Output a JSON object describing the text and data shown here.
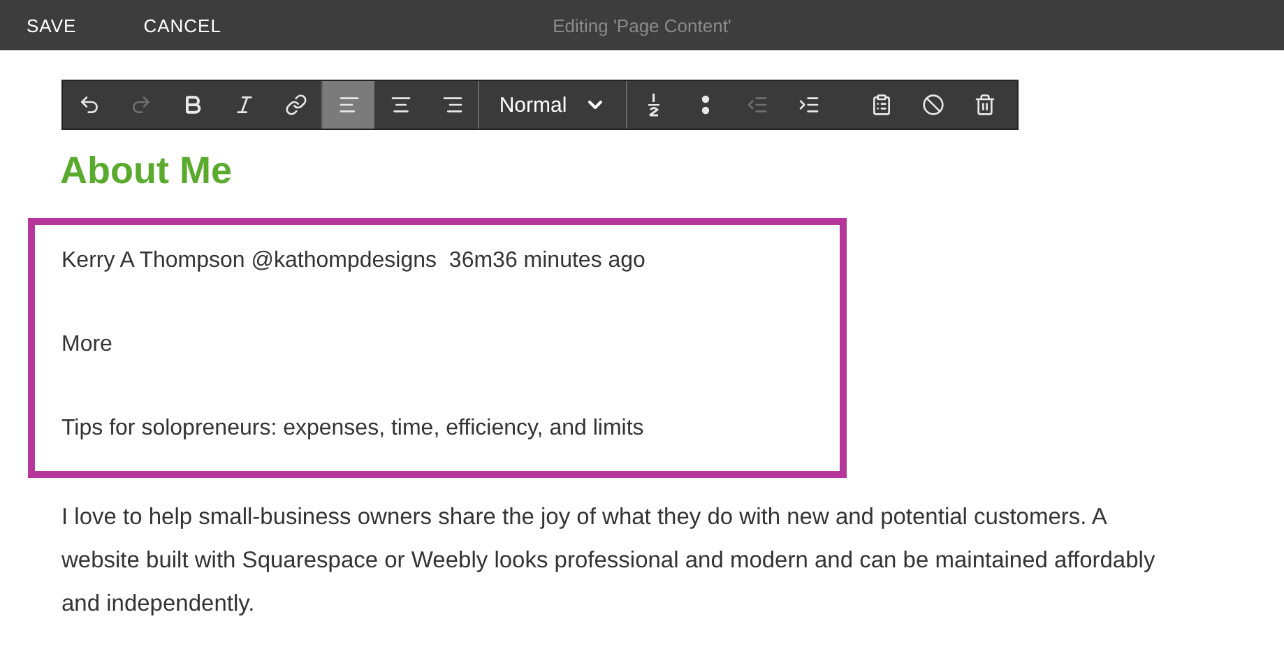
{
  "top_bar": {
    "buttons": [
      "SAVE",
      "CANCEL"
    ],
    "title": "Editing 'Page Content'"
  },
  "toolbar": {
    "groups": [
      {
        "kind": "buttons",
        "items": [
          {
            "kind": "undo",
            "disabled": false,
            "selected": false
          },
          {
            "kind": "redo",
            "disabled": true,
            "selected": false
          },
          {
            "kind": "bold",
            "disabled": false,
            "selected": false
          },
          {
            "kind": "italic",
            "disabled": false,
            "selected": false
          },
          {
            "kind": "link",
            "disabled": false,
            "selected": false
          }
        ]
      },
      {
        "kind": "buttons",
        "items": [
          {
            "kind": "align-left",
            "disabled": false,
            "selected": true
          },
          {
            "kind": "align-center",
            "disabled": false,
            "selected": false
          },
          {
            "kind": "align-right",
            "disabled": false,
            "selected": false
          }
        ]
      },
      {
        "kind": "dropdown",
        "value": "Normal"
      },
      {
        "kind": "buttons",
        "items": [
          {
            "kind": "numbered-list",
            "disabled": false,
            "selected": false
          },
          {
            "kind": "bullet-list",
            "disabled": false,
            "selected": false
          },
          {
            "kind": "outdent",
            "disabled": true,
            "selected": false
          },
          {
            "kind": "indent",
            "disabled": false,
            "selected": false
          },
          {
            "kind": "paste",
            "disabled": false,
            "selected": false
          },
          {
            "kind": "clear-format",
            "disabled": false,
            "selected": false
          },
          {
            "kind": "delete",
            "disabled": false,
            "selected": false
          }
        ]
      }
    ]
  },
  "heading": "About Me",
  "highlighted_box": {
    "lines": [
      "Kerry A Thompson @kathompdesigns  36m36 minutes ago",
      "More",
      "Tips for solopreneurs: expenses, time, efficiency, and limits"
    ]
  },
  "paragraph": "I love to help small-business owners share the joy of what they do with new and potential customers. A website built with Squarespace or Weebly looks professional and modern and can be maintained affordably and independently."
}
